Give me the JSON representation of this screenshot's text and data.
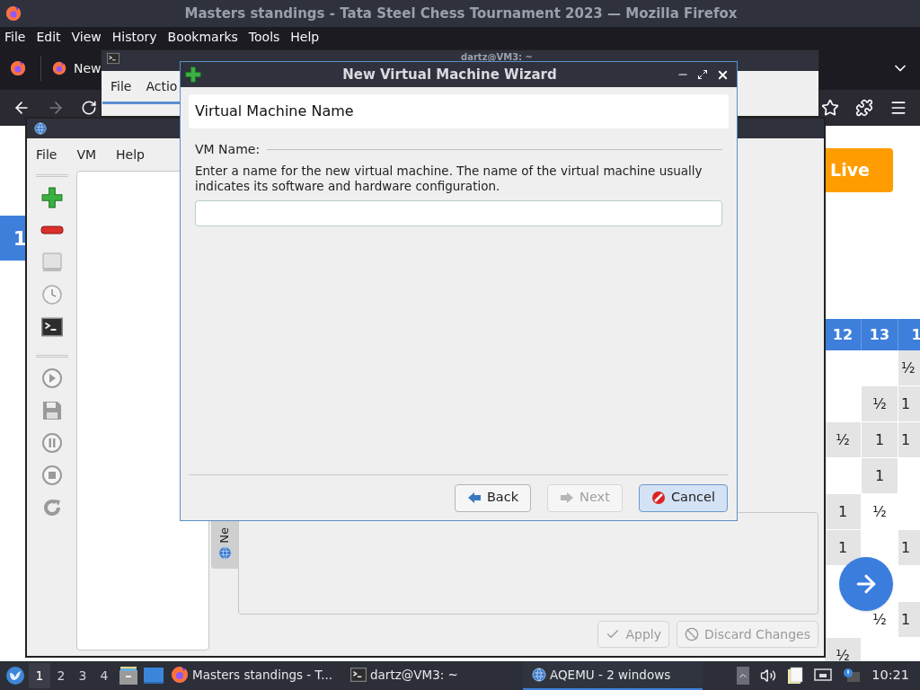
{
  "firefox": {
    "title": "Masters standings - Tata Steel Chess Tournament 2023 — Mozilla Firefox",
    "menu": [
      "File",
      "Edit",
      "View",
      "History",
      "Bookmarks",
      "Tools",
      "Help"
    ],
    "tab": {
      "label": "New"
    },
    "page": {
      "round_badge": "1",
      "live_button": "Live",
      "table": {
        "columns": [
          "12",
          "13",
          "1"
        ],
        "rows": [
          [
            {
              "shaded": false
            },
            {
              "shaded": false
            },
            {
              "text": "½",
              "shaded": true
            }
          ],
          [
            {
              "shaded": false
            },
            {
              "text": "½",
              "shaded": true
            },
            {
              "text": "1",
              "shaded": true
            }
          ],
          [
            {
              "text": "½",
              "shaded": true
            },
            {
              "text": "1",
              "shaded": true
            },
            {
              "text": "1",
              "shaded": true
            }
          ],
          [
            {
              "shaded": false
            },
            {
              "text": "1",
              "shaded": true
            },
            {
              "shaded": false
            }
          ],
          [
            {
              "text": "1",
              "shaded": true
            },
            {
              "text": "½",
              "shaded": false
            },
            {
              "shaded": false
            }
          ],
          [
            {
              "text": "1",
              "shaded": true
            },
            {
              "shaded": false
            },
            {
              "text": "1",
              "shaded": true
            }
          ],
          [
            {
              "shaded": false
            },
            {
              "shaded": false
            },
            {
              "shaded": false
            }
          ],
          [
            {
              "shaded": false
            },
            {
              "text": "½",
              "shaded": false
            },
            {
              "text": "1",
              "shaded": true
            }
          ],
          [
            {
              "text": "½",
              "shaded": true
            },
            {
              "shaded": false
            },
            {
              "shaded": false
            }
          ]
        ]
      }
    }
  },
  "terminal": {
    "title": "dartz@VM3: ~",
    "menu": [
      "File",
      "Actio"
    ]
  },
  "aqemu": {
    "menu": [
      "File",
      "VM",
      "Help"
    ],
    "side_tab": "Ne",
    "buttons": [
      {
        "label": "Apply",
        "kind": "apply",
        "disabled": true
      },
      {
        "label": "Discard Changes",
        "kind": "discard",
        "disabled": true
      }
    ]
  },
  "wizard": {
    "title": "New Virtual Machine Wizard",
    "header": "Virtual Machine Name",
    "group": "VM Name:",
    "description": "Enter a name for the new virtual machine. The name of the virtual machine usually indicates its software and hardware configuration.",
    "buttons": [
      {
        "label": "Back",
        "kind": "back",
        "disabled": false,
        "focused": false
      },
      {
        "label": "Next",
        "kind": "next",
        "disabled": true,
        "focused": false
      },
      {
        "label": "Cancel",
        "kind": "cancel",
        "disabled": false,
        "focused": true
      }
    ]
  },
  "taskbar": {
    "workspaces": [
      {
        "label": "1",
        "selected": true
      },
      {
        "label": "2",
        "selected": false
      },
      {
        "label": "3",
        "selected": false
      },
      {
        "label": "4",
        "selected": false
      }
    ],
    "tasks": [
      {
        "label": "Masters standings - T...",
        "kind": "firefox",
        "selected": false
      },
      {
        "label": "dartz@VM3: ~",
        "kind": "terminal",
        "selected": false
      },
      {
        "label": "AQEMU - 2 windows",
        "kind": "aqemu",
        "selected": true
      }
    ],
    "clock": "10:21"
  }
}
